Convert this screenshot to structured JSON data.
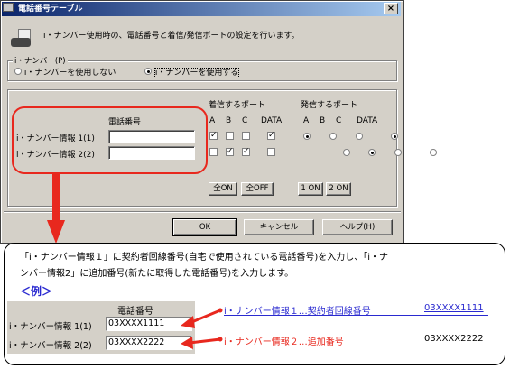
{
  "dialog": {
    "title": "電話番号テーブル",
    "close_label": "×",
    "description": "i・ナンバー使用時の、電話番号と着信/発信ポートの設定を行います。",
    "inumber_group": {
      "legend": "i・ナンバー(P)",
      "option_off": "i・ナンバーを使用しない",
      "option_on": "i・ナンバーを使用する"
    },
    "table": {
      "phone_header": "電話番号",
      "incoming_header": "着信するポート",
      "outgoing_header": "発信するポート",
      "port_labels": [
        "A",
        "B",
        "C",
        "DATA"
      ],
      "rows": [
        {
          "label": "i・ナンバー情報 1(1)",
          "phone": "",
          "incoming": [
            true,
            false,
            false,
            true
          ],
          "outgoing": [
            true,
            false,
            false,
            true
          ]
        },
        {
          "label": "i・ナンバー情報 2(2)",
          "phone": "",
          "incoming": [
            false,
            true,
            true,
            false
          ],
          "outgoing": [
            false,
            true,
            false,
            false
          ]
        }
      ]
    },
    "buttons": {
      "all_on": "全ON",
      "all_off": "全OFF",
      "one_on": "1 ON",
      "two_on": "2 ON",
      "ok": "OK",
      "cancel": "キャンセル",
      "help": "ヘルプ(H)"
    }
  },
  "callout": {
    "line1": "「i・ナンバー情報１」に契約者回線番号(自宅で使用されている電話番号)を入力し、「i・ナ",
    "line2": "ンバー情報2」に追加番号(新たに取得した電話番号)を入力します。",
    "example_label": "＜例＞",
    "example": {
      "header": "電話番号",
      "rows": [
        {
          "label": "i・ナンバー情報 1(1)",
          "value": "03XXXX1111"
        },
        {
          "label": "i・ナンバー情報 2(2)",
          "value": "03XXXX2222"
        }
      ]
    },
    "notes": [
      {
        "text": "i・ナンバー情報１…契約者回線番号",
        "number": "03XXXX1111"
      },
      {
        "text": "i・ナンバー情報２…追加番号",
        "number": "03XXXX2222"
      }
    ]
  },
  "colors": {
    "highlight": "#e8281e",
    "link_blue": "#2a2ad0",
    "titlebar": "#0a246a"
  }
}
